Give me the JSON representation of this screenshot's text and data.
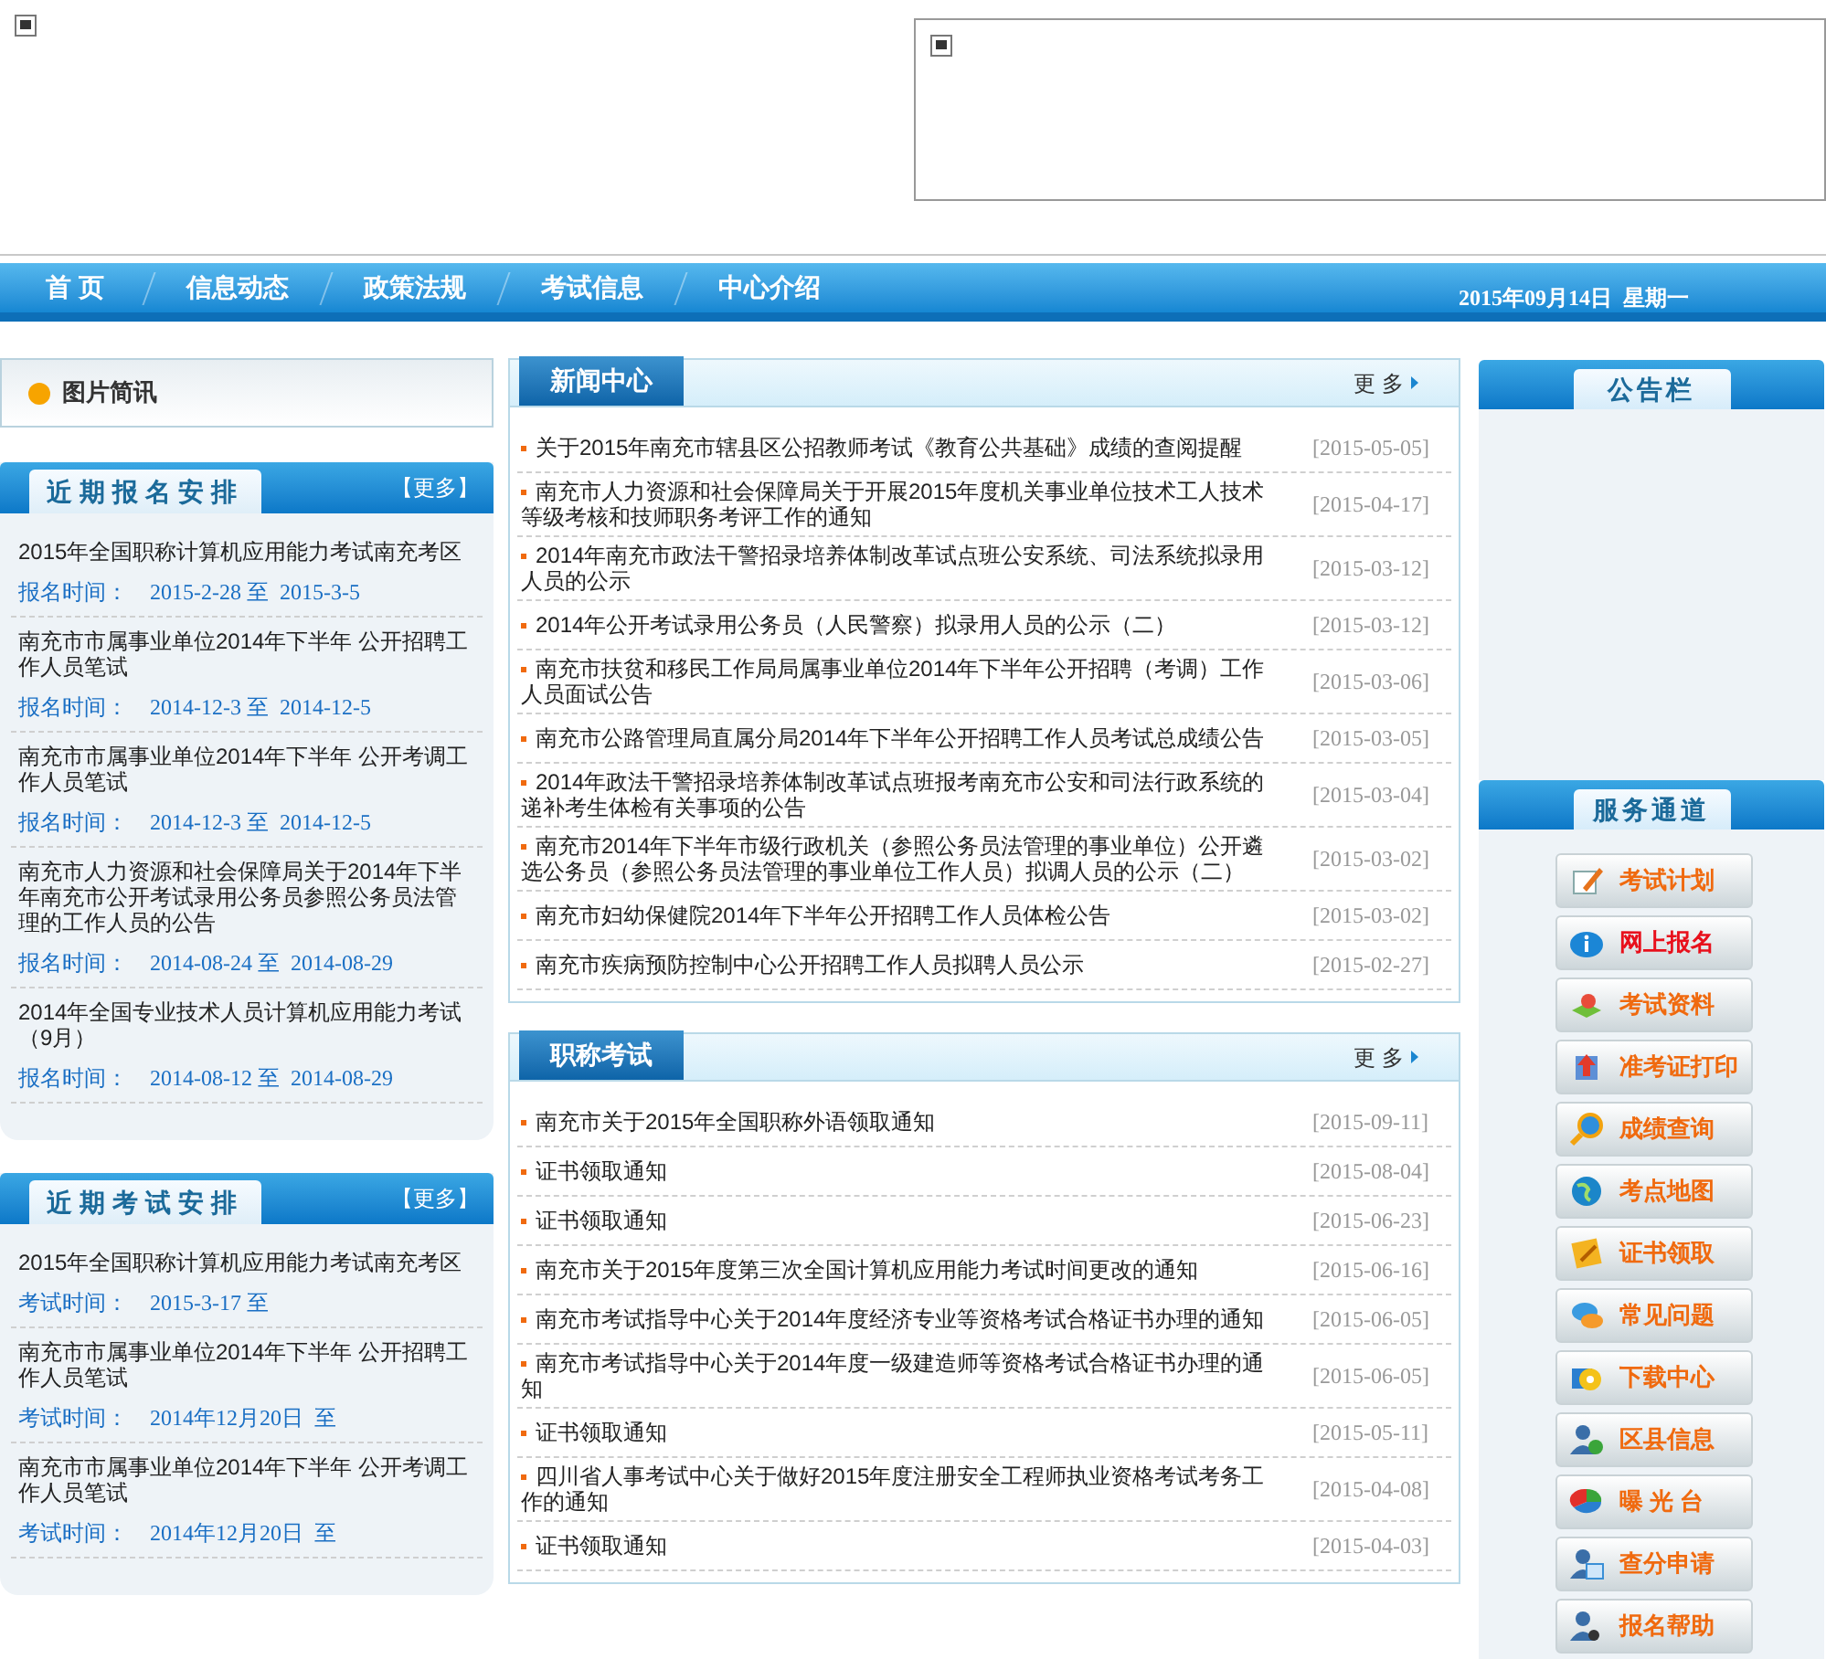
{
  "nav": {
    "items": [
      {
        "label": "首 页"
      },
      {
        "label": "信息动态"
      },
      {
        "label": "政策法规"
      },
      {
        "label": "考试信息"
      },
      {
        "label": "中心介绍"
      }
    ],
    "date": "2015年09月14日  星期一"
  },
  "photo_news": {
    "title": "图片简讯"
  },
  "left_panels": [
    {
      "title": "近期报名安排",
      "more": "【更多】",
      "items": [
        {
          "title": "2015年全国职称计算机应用能力考试南充考区",
          "label": "报名时间：",
          "dates": "2015-2-28 至  2015-3-5"
        },
        {
          "title": "南充市市属事业单位2014年下半年  公开招聘工作人员笔试",
          "label": "报名时间：",
          "dates": "2014-12-3 至  2014-12-5"
        },
        {
          "title": "南充市市属事业单位2014年下半年  公开考调工作人员笔试",
          "label": "报名时间：",
          "dates": "2014-12-3 至  2014-12-5"
        },
        {
          "title": "南充市人力资源和社会保障局关于2014年下半年南充市公开考试录用公务员参照公务员法管理的工作人员的公告",
          "label": "报名时间：",
          "dates": "2014-08-24 至  2014-08-29"
        },
        {
          "title": "2014年全国专业技术人员计算机应用能力考试（9月）",
          "label": "报名时间：",
          "dates": "2014-08-12 至  2014-08-29"
        }
      ]
    },
    {
      "title": "近期考试安排",
      "more": "【更多】",
      "items": [
        {
          "title": "2015年全国职称计算机应用能力考试南充考区",
          "label": "考试时间：",
          "dates": "2015-3-17 至"
        },
        {
          "title": "南充市市属事业单位2014年下半年  公开招聘工作人员笔试",
          "label": "考试时间：",
          "dates": "2014年12月20日  至"
        },
        {
          "title": "南充市市属事业单位2014年下半年  公开考调工作人员笔试",
          "label": "考试时间：",
          "dates": "2014年12月20日  至"
        }
      ]
    }
  ],
  "news_sections": [
    {
      "title": "新闻中心",
      "more": "更 多",
      "rows": [
        {
          "title": "关于2015年南充市辖县区公招教师考试《教育公共基础》成绩的查阅提醒",
          "date": "[2015-05-05]"
        },
        {
          "title": "南充市人力资源和社会保障局关于开展2015年度机关事业单位技术工人技术等级考核和技师职务考评工作的通知",
          "date": "[2015-04-17]"
        },
        {
          "title": "2014年南充市政法干警招录培养体制改革试点班公安系统、司法系统拟录用人员的公示",
          "date": "[2015-03-12]"
        },
        {
          "title": "2014年公开考试录用公务员（人民警察）拟录用人员的公示（二）",
          "date": "[2015-03-12]"
        },
        {
          "title": "南充市扶贫和移民工作局局属事业单位2014年下半年公开招聘（考调）工作人员面试公告",
          "date": "[2015-03-06]"
        },
        {
          "title": "南充市公路管理局直属分局2014年下半年公开招聘工作人员考试总成绩公告",
          "date": "[2015-03-05]"
        },
        {
          "title": "2014年政法干警招录培养体制改革试点班报考南充市公安和司法行政系统的递补考生体检有关事项的公告",
          "date": "[2015-03-04]"
        },
        {
          "title": "南充市2014年下半年市级行政机关（参照公务员法管理的事业单位）公开遴选公务员（参照公务员法管理的事业单位工作人员）拟调人员的公示（二）",
          "date": "[2015-03-02]"
        },
        {
          "title": "南充市妇幼保健院2014年下半年公开招聘工作人员体检公告",
          "date": "[2015-03-02]"
        },
        {
          "title": "南充市疾病预防控制中心公开招聘工作人员拟聘人员公示",
          "date": "[2015-02-27]"
        }
      ]
    },
    {
      "title": "职称考试",
      "more": "更 多",
      "rows": [
        {
          "title": "南充市关于2015年全国职称外语领取通知",
          "date": "[2015-09-11]"
        },
        {
          "title": "证书领取通知",
          "date": "[2015-08-04]"
        },
        {
          "title": "证书领取通知",
          "date": "[2015-06-23]"
        },
        {
          "title": "南充市关于2015年度第三次全国计算机应用能力考试时间更改的通知",
          "date": "[2015-06-16]"
        },
        {
          "title": "南充市考试指导中心关于2014年度经济专业等资格考试合格证书办理的通知",
          "date": "[2015-06-05]"
        },
        {
          "title": "南充市考试指导中心关于2014年度一级建造师等资格考试合格证书办理的通知",
          "date": "[2015-06-05]"
        },
        {
          "title": "证书领取通知",
          "date": "[2015-05-11]"
        },
        {
          "title": "四川省人事考试中心关于做好2015年度注册安全工程师执业资格考试考务工作的通知",
          "date": "[2015-04-08]"
        },
        {
          "title": "证书领取通知",
          "date": "[2015-04-03]"
        }
      ]
    }
  ],
  "notice_board": {
    "title": "公告栏"
  },
  "services": {
    "title": "服务通道",
    "buttons": [
      {
        "label": "考试计划",
        "color": "#f06a0f"
      },
      {
        "label": "网上报名",
        "color": "#e8101c"
      },
      {
        "label": "考试资料",
        "color": "#f06a0f"
      },
      {
        "label": "准考证打印",
        "color": "#f06a0f"
      },
      {
        "label": "成绩查询",
        "color": "#f06a0f"
      },
      {
        "label": "考点地图",
        "color": "#f06a0f"
      },
      {
        "label": "证书领取",
        "color": "#f06a0f"
      },
      {
        "label": "常见问题",
        "color": "#f06a0f"
      },
      {
        "label": "下载中心",
        "color": "#f06a0f"
      },
      {
        "label": "区县信息",
        "color": "#f06a0f"
      },
      {
        "label": "曝 光 台",
        "color": "#f06a0f"
      },
      {
        "label": "查分申请",
        "color": "#f06a0f"
      },
      {
        "label": "报名帮助",
        "color": "#f06a0f"
      }
    ]
  }
}
